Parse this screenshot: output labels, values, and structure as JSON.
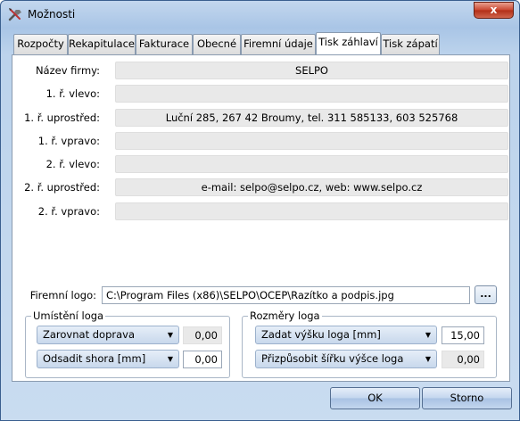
{
  "window": {
    "title": "Možnosti",
    "close_glyph": "x",
    "icon": "tools-icon"
  },
  "tabs": [
    {
      "label": "Rozpočty"
    },
    {
      "label": "Rekapitulace"
    },
    {
      "label": "Fakturace"
    },
    {
      "label": "Obecné"
    },
    {
      "label": "Firemní údaje"
    },
    {
      "label": "Tisk záhlaví"
    },
    {
      "label": "Tisk zápatí"
    }
  ],
  "active_tab": "Tisk záhlaví",
  "header_fields": [
    {
      "label": "Název firmy:",
      "value": "SELPO"
    },
    {
      "label": "1. ř. vlevo:",
      "value": ""
    },
    {
      "label": "1. ř. uprostřed:",
      "value": "Luční 285, 267 42 Broumy, tel. 311 585133, 603 525768"
    },
    {
      "label": "1. ř. vpravo:",
      "value": ""
    },
    {
      "label": "2. ř. vlevo:",
      "value": ""
    },
    {
      "label": "2. ř. uprostřed:",
      "value": "e-mail: selpo@selpo.cz, web: www.selpo.cz"
    },
    {
      "label": "2. ř. vpravo:",
      "value": ""
    }
  ],
  "logo": {
    "label": "Firemní logo:",
    "path": "C:\\Program Files (x86)\\SELPO\\OCEP\\Razítko a podpis.jpg",
    "browse_label": "..."
  },
  "placement": {
    "title": "Umístění loga",
    "align_combo": "Zarovnat doprava",
    "align_value": "0,00",
    "offset_combo": "Odsadit shora [mm]",
    "offset_value": "0,00"
  },
  "size": {
    "title": "Rozměry loga",
    "height_combo": "Zadat výšku loga [mm]",
    "height_value": "15,00",
    "width_combo": "Přizpůsobit šířku výšce loga",
    "width_value": "0,00"
  },
  "buttons": {
    "ok": "OK",
    "cancel": "Storno"
  },
  "colors": {
    "title_bar": "#a9c5e6",
    "close_button": "#c9452e",
    "readonly_field": "#e9e9e9"
  }
}
